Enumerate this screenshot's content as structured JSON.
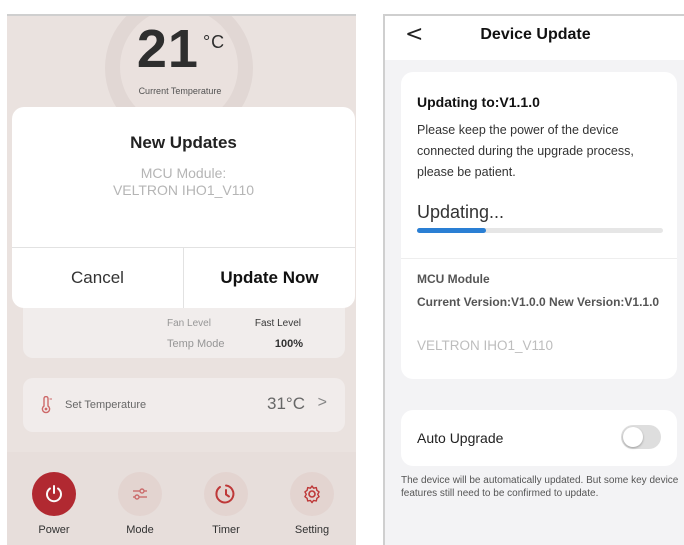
{
  "left_screen": {
    "current_temperature": {
      "value": "21",
      "unit": "°C",
      "caption": "Current Temperature"
    },
    "status_rows": [
      {
        "label": "Fan Level",
        "value": "Fast Level"
      },
      {
        "label": "Temp Mode",
        "value": "100%"
      }
    ],
    "set_temperature": {
      "label": "Set Temperature",
      "value": "31°C",
      "chevron": ">"
    },
    "bottom_nav": [
      {
        "label": "Power",
        "icon": "power-icon"
      },
      {
        "label": "Mode",
        "icon": "sliders-icon"
      },
      {
        "label": "Timer",
        "icon": "timer-icon"
      },
      {
        "label": "Setting",
        "icon": "gear-icon"
      }
    ],
    "dialog": {
      "title": "New Updates",
      "module_line1": "MCU Module:",
      "module_line2": "VELTRON IHO1_V110",
      "cancel_label": "Cancel",
      "update_label": "Update Now"
    },
    "colors": {
      "power_accent": "#b52a32"
    }
  },
  "right_screen": {
    "header": {
      "back": "<",
      "title": "Device Update"
    },
    "update_card": {
      "updating_to": "Updating to:V1.1.0",
      "note": "Please keep the power of the device connected during the upgrade process, please be patient.",
      "status": "Updating...",
      "progress": 0.28,
      "module_name": "MCU Module",
      "version_info": "Current Version:V1.0.0 New Version:V1.1.0",
      "module_id": "VELTRON IHO1_V110"
    },
    "auto_upgrade": {
      "label": "Auto Upgrade",
      "enabled": false
    },
    "footnote": "The device will be automatically updated. But some key device features still need to be confirmed to update.",
    "colors": {
      "progress": "#2a7fd4"
    }
  }
}
